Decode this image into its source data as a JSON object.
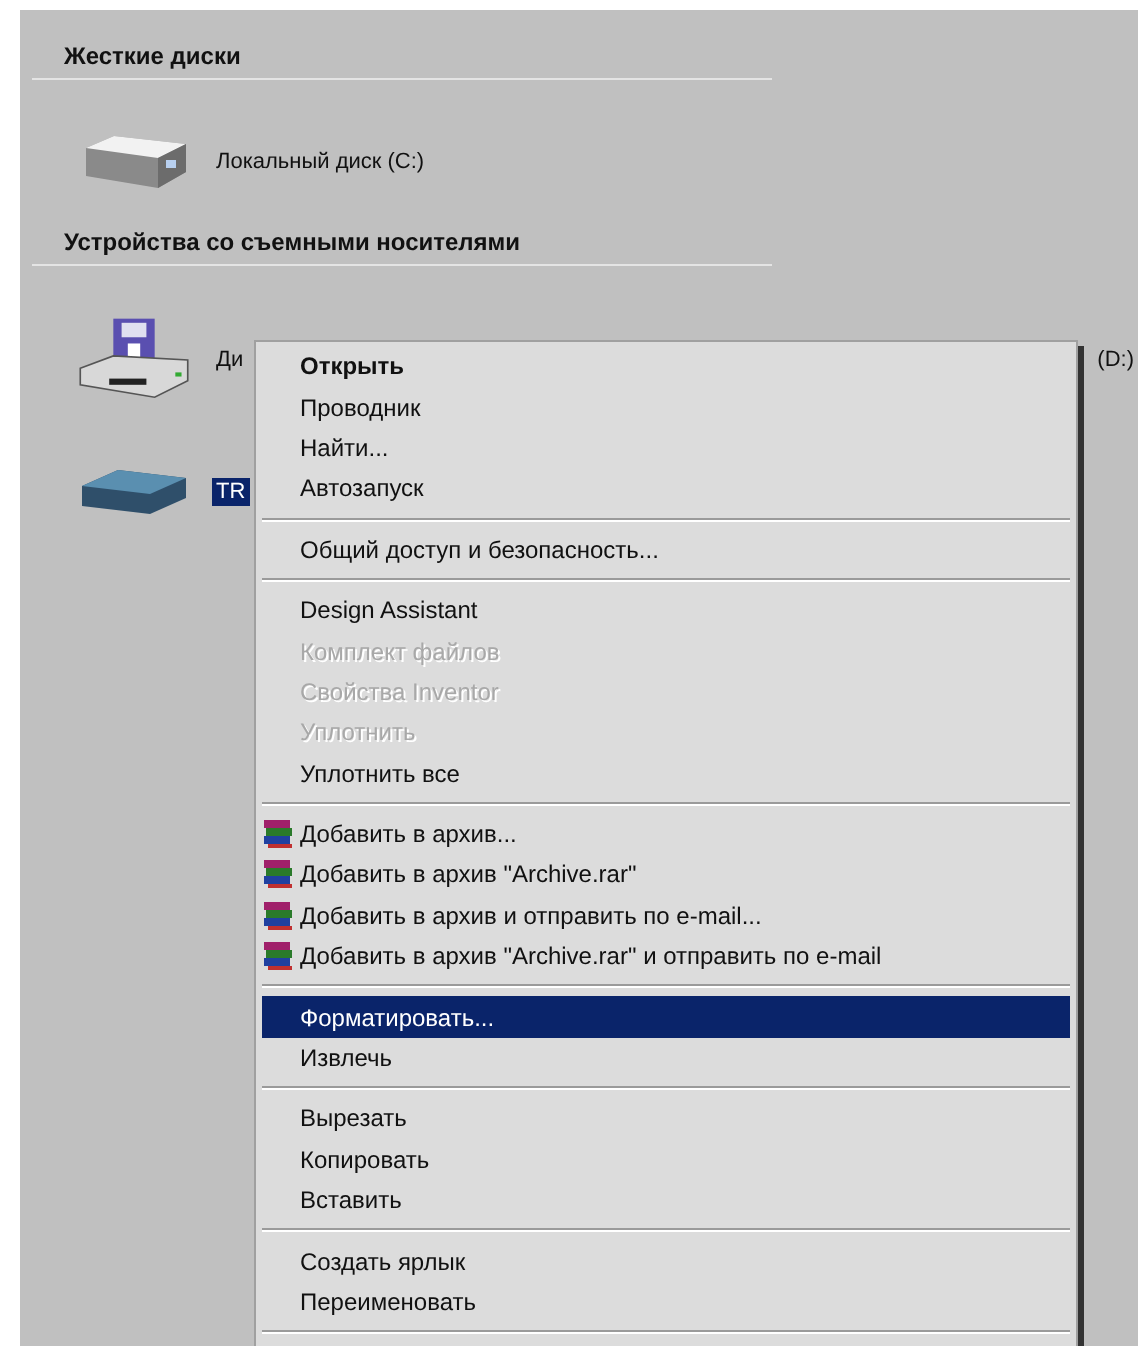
{
  "sections": [
    {
      "title": "Жесткие диски",
      "devices": [
        {
          "kind": "hdd",
          "label": "Локальный диск (C:)",
          "selected": false
        }
      ]
    },
    {
      "title": "Устройства со съемными носителями",
      "devices": [
        {
          "kind": "floppy",
          "label": "Ди",
          "label_right": "(D:)",
          "selected": false
        },
        {
          "kind": "removable",
          "label": "TR",
          "selected": true
        }
      ]
    }
  ],
  "context_menu": {
    "groups": [
      [
        {
          "label": "Открыть",
          "default": true,
          "disabled": false,
          "selected": false
        },
        {
          "label": "Проводник",
          "default": false,
          "disabled": false,
          "selected": false
        },
        {
          "label": "Найти...",
          "default": false,
          "disabled": false,
          "selected": false
        },
        {
          "label": "Автозапуск",
          "default": false,
          "disabled": false,
          "selected": false
        }
      ],
      [
        {
          "label": "Общий доступ и безопасность...",
          "default": false,
          "disabled": false,
          "selected": false
        }
      ],
      [
        {
          "label": "Design Assistant",
          "default": false,
          "disabled": false,
          "selected": false
        },
        {
          "label": "Комплект файлов",
          "default": false,
          "disabled": true,
          "selected": false
        },
        {
          "label": "Свойства Inventor",
          "default": false,
          "disabled": true,
          "selected": false
        },
        {
          "label": "Уплотнить",
          "default": false,
          "disabled": true,
          "selected": false
        },
        {
          "label": "Уплотнить все",
          "default": false,
          "disabled": false,
          "selected": false
        }
      ],
      [
        {
          "label": "Добавить в архив...",
          "kind": "archive",
          "default": false,
          "disabled": false,
          "selected": false
        },
        {
          "label": "Добавить в архив \"Archive.rar\"",
          "kind": "archive",
          "default": false,
          "disabled": false,
          "selected": false
        },
        {
          "label": "Добавить в архив и отправить по e-mail...",
          "kind": "archive",
          "default": false,
          "disabled": false,
          "selected": false
        },
        {
          "label": "Добавить в архив \"Archive.rar\" и отправить по e-mail",
          "kind": "archive",
          "default": false,
          "disabled": false,
          "selected": false
        }
      ],
      [
        {
          "label": "Форматировать...",
          "default": false,
          "disabled": false,
          "selected": true
        },
        {
          "label": "Извлечь",
          "default": false,
          "disabled": false,
          "selected": false
        }
      ],
      [
        {
          "label": "Вырезать",
          "default": false,
          "disabled": false,
          "selected": false
        },
        {
          "label": "Копировать",
          "default": false,
          "disabled": false,
          "selected": false
        },
        {
          "label": "Вставить",
          "default": false,
          "disabled": false,
          "selected": false
        }
      ],
      [
        {
          "label": "Создать ярлык",
          "default": false,
          "disabled": false,
          "selected": false
        },
        {
          "label": "Переименовать",
          "default": false,
          "disabled": false,
          "selected": false
        }
      ]
    ]
  }
}
